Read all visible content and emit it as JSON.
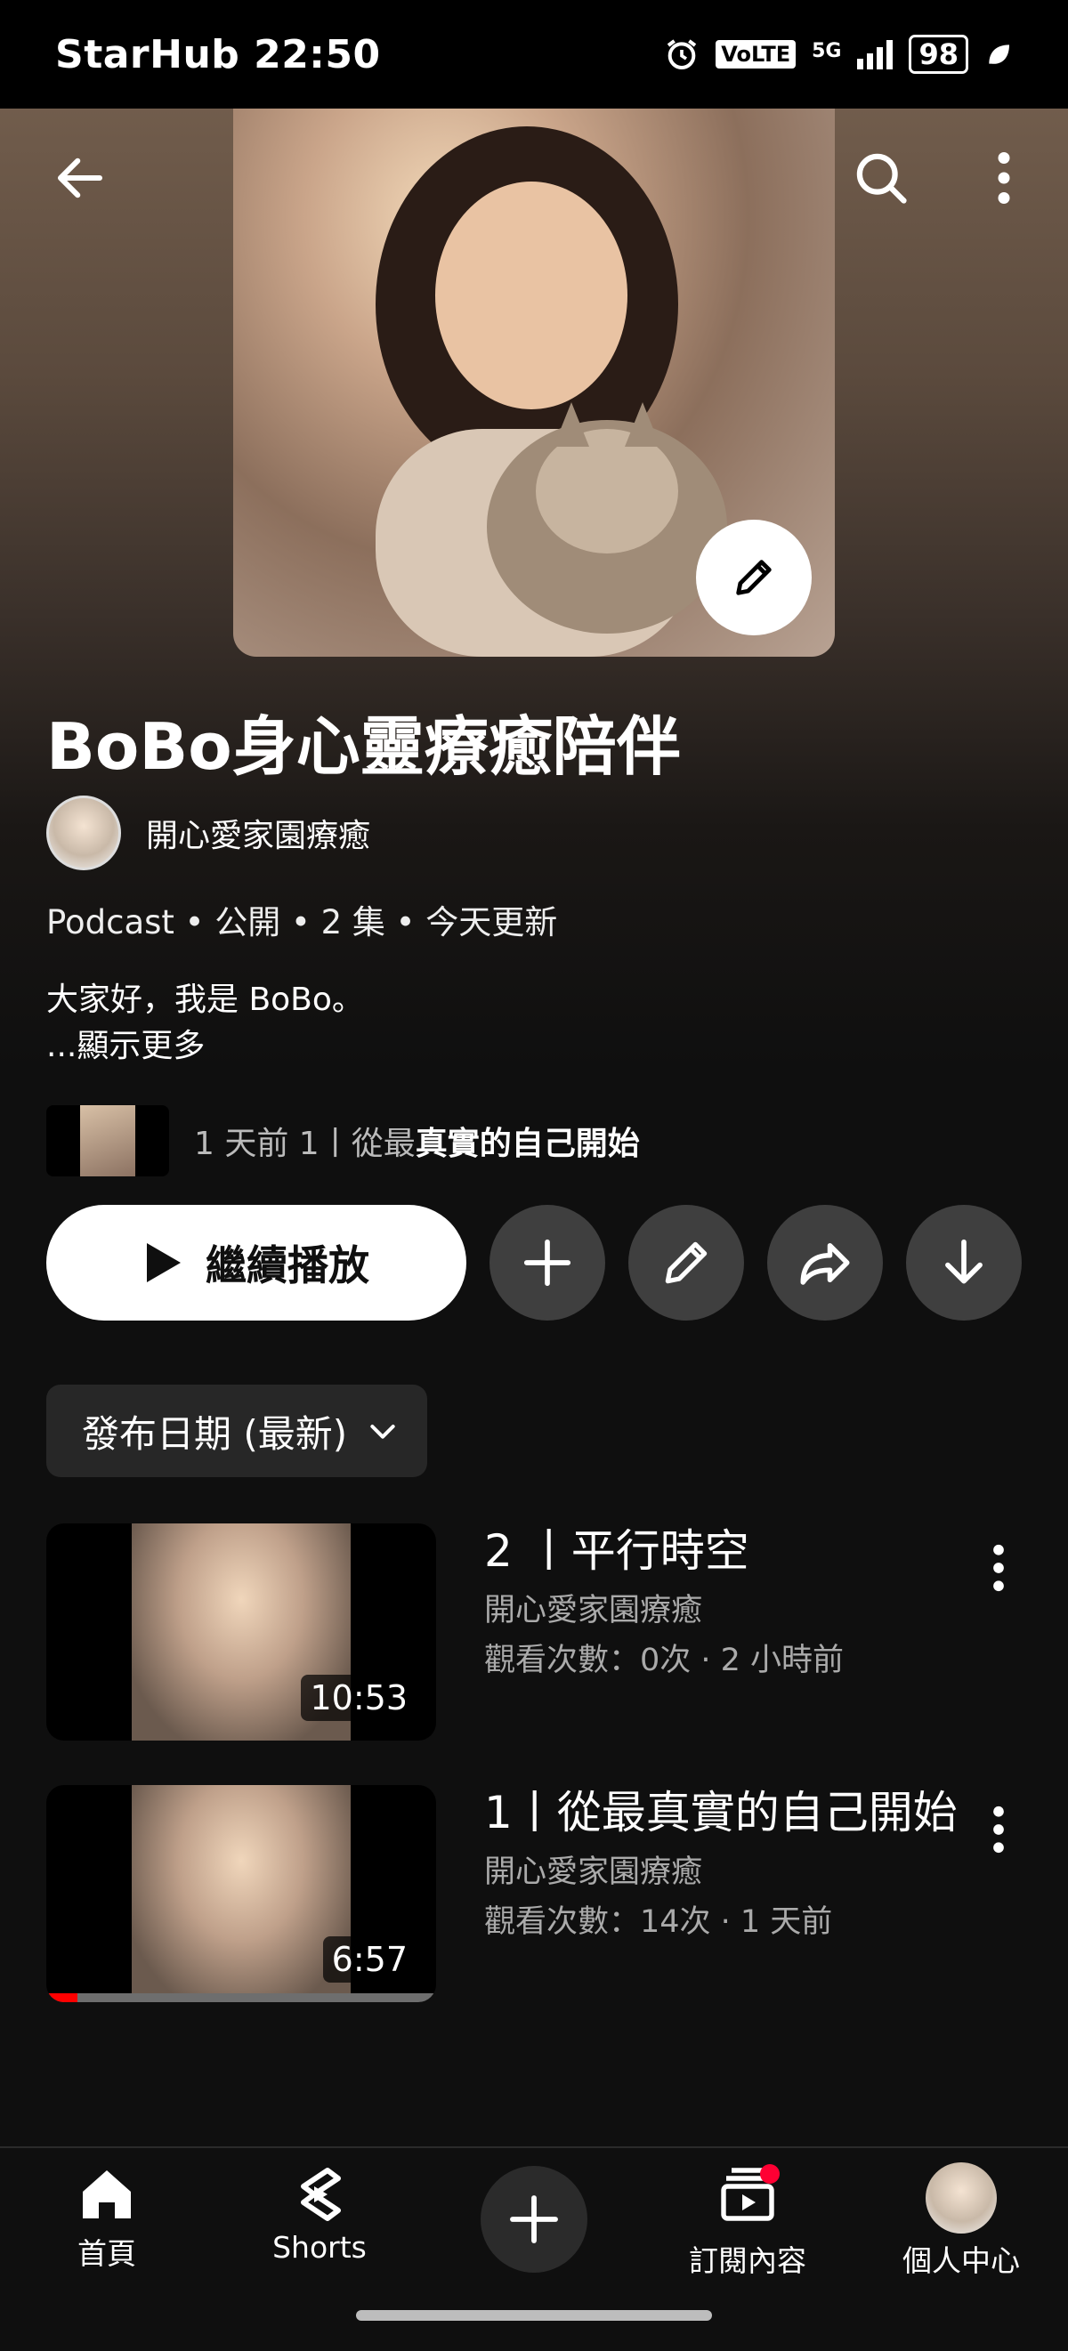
{
  "status_bar": {
    "carrier_time": "StarHub 22:50",
    "volte": "VoLTE",
    "network": "5G",
    "battery": "98"
  },
  "playlist": {
    "title": "BoBo身心靈療癒陪伴",
    "channel": "開心愛家園療癒",
    "meta": "Podcast • 公開 • 2 集 • 今天更新",
    "description": "大家好，我是 BoBo。",
    "show_more": "...顯示更多",
    "latest_prefix": "1 天前 1丨從最",
    "latest_bold": "真實的自己開始"
  },
  "actions": {
    "play_label": "繼續播放"
  },
  "sort": {
    "label": "發布日期 (最新)"
  },
  "episodes": [
    {
      "title": "2 丨平行時空",
      "channel": "開心愛家園療癒",
      "stats": "觀看次數：0次 · 2 小時前",
      "duration": "10:53",
      "progress": 0
    },
    {
      "title": "1丨從最真實的自己開始",
      "channel": "開心愛家園療癒",
      "stats": "觀看次數：14次 · 1 天前",
      "duration": "6:57",
      "progress": 0.08
    }
  ],
  "nav": {
    "home": "首頁",
    "shorts": "Shorts",
    "subscriptions": "訂閱內容",
    "profile": "個人中心"
  },
  "colors": {
    "background": "#0f0f0f",
    "accent_red": "#ff0000"
  }
}
